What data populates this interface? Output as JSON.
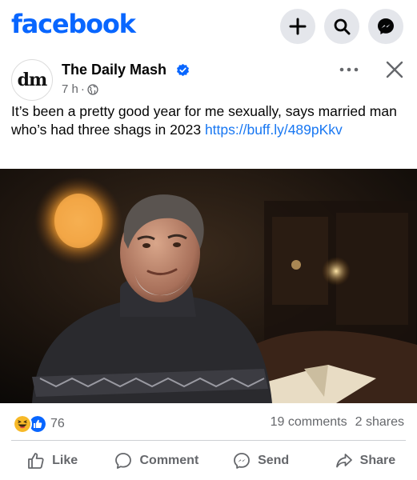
{
  "app": {
    "logo_text": "facebook",
    "brand_color": "#0866ff",
    "top_actions": [
      "plus-icon",
      "search-icon",
      "messenger-icon"
    ]
  },
  "post": {
    "author": {
      "avatar_text": "dm",
      "name": "The Daily Mash",
      "verified": true
    },
    "time": "7 h",
    "separator": "·",
    "audience_icon": "globe-icon",
    "caption_text": "It’s been a pretty good year for me sexually, says married man who’s had three shags in 2023 ",
    "link_text": "https://buff.ly/489pKkv",
    "image_icon": "photo",
    "reaction_icons": [
      "haha-reaction-icon",
      "like-reaction-icon"
    ],
    "reaction_count": "76",
    "comments": "19 comments",
    "shares": "2 shares"
  },
  "actions": [
    {
      "label": "Like",
      "icon": "thumbs-up-icon"
    },
    {
      "label": "Comment",
      "icon": "comment-icon"
    },
    {
      "label": "Send",
      "icon": "messenger-icon"
    },
    {
      "label": "Share",
      "icon": "share-icon"
    }
  ]
}
